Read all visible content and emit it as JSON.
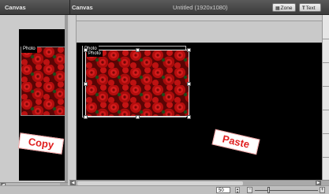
{
  "left_panel": {
    "title": "Canvas"
  },
  "main_panel": {
    "title": "Canvas",
    "document_title": "Untitled (1920x1080)",
    "zone_button": {
      "label": "Zone",
      "icon": "zone-grid-icon"
    },
    "text_button": {
      "label": "Text",
      "icon": "text-t-icon"
    }
  },
  "photos": {
    "left_label": "Photo",
    "back_label": "Photo",
    "front_label": "Photo",
    "subject": "red roses"
  },
  "annotations": {
    "copy": "Copy",
    "paste": "Paste"
  },
  "zoom": {
    "value": "50",
    "minus": "−",
    "plus": "+",
    "slider_fraction": 0.2
  },
  "colors": {
    "titlebar": "#3b3b3b",
    "canvas": "#000000",
    "annotation_red": "#e02020",
    "rose": "#b40e0e",
    "leaf": "#1f4a1a"
  }
}
